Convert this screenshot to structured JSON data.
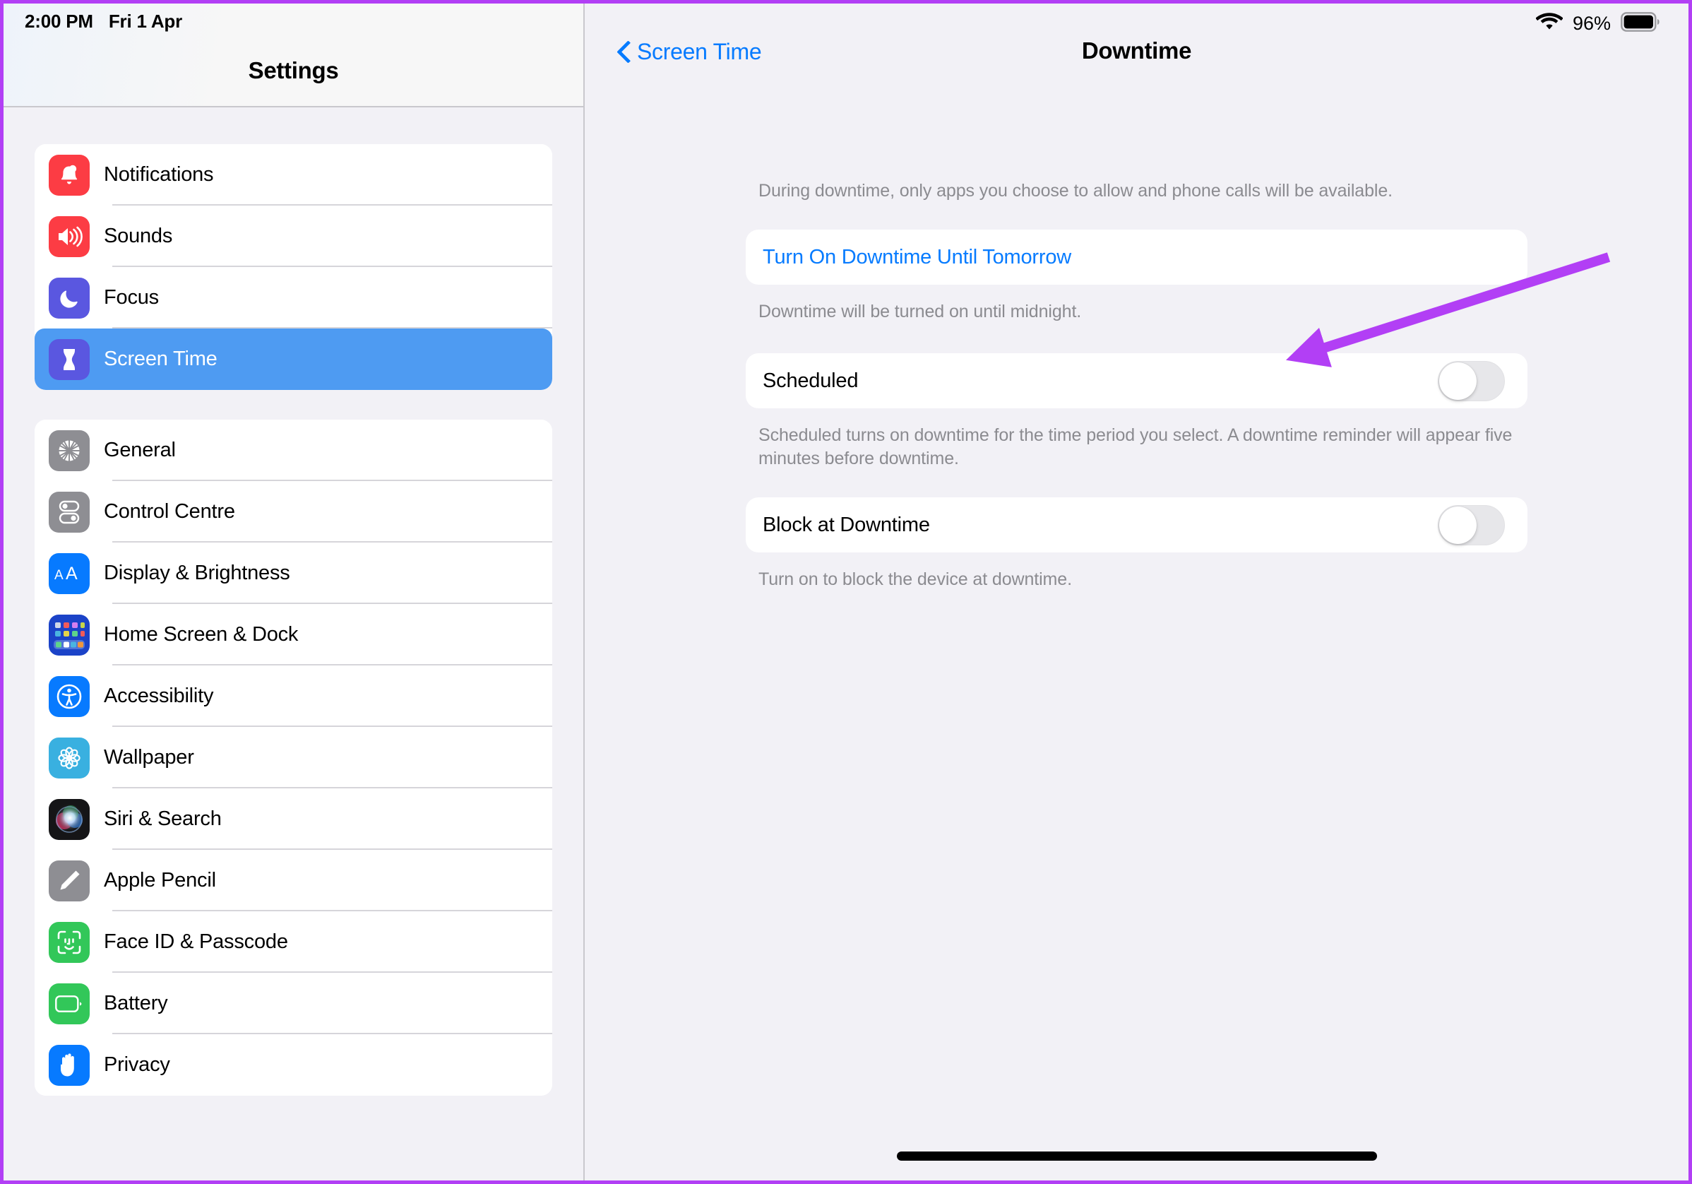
{
  "annotation": {
    "arrow_color": "#b23ff5",
    "frame_color": "#b23ff5"
  },
  "status_bar": {
    "time": "2:00 PM",
    "date": "Fri 1 Apr",
    "wifi_icon": "wifi-icon",
    "battery_percent": "96%",
    "battery_icon": "battery-full-icon"
  },
  "sidebar": {
    "title": "Settings",
    "groups": [
      {
        "items": [
          {
            "label": "Notifications",
            "icon": "bell-icon",
            "icon_bg": "#fc3c44",
            "selected": false
          },
          {
            "label": "Sounds",
            "icon": "speaker-waves-icon",
            "icon_bg": "#fc3c44",
            "selected": false
          },
          {
            "label": "Focus",
            "icon": "moon-icon",
            "icon_bg": "#5a57e0",
            "selected": false
          },
          {
            "label": "Screen Time",
            "icon": "hourglass-icon",
            "icon_bg": "#5a57e0",
            "selected": true
          }
        ]
      },
      {
        "items": [
          {
            "label": "General",
            "icon": "gear-icon",
            "icon_bg": "#8e8e93",
            "selected": false
          },
          {
            "label": "Control Centre",
            "icon": "control-toggles-icon",
            "icon_bg": "#8e8e93",
            "selected": false
          },
          {
            "label": "Display & Brightness",
            "icon": "aa-text-icon",
            "icon_bg": "#077aff",
            "selected": false
          },
          {
            "label": "Home Screen & Dock",
            "icon": "home-screen-grid-icon",
            "icon_bg": "#1b43c8",
            "selected": false
          },
          {
            "label": "Accessibility",
            "icon": "accessibility-person-icon",
            "icon_bg": "#077aff",
            "selected": false
          },
          {
            "label": "Wallpaper",
            "icon": "flower-icon",
            "icon_bg": "#39b0e0",
            "selected": false
          },
          {
            "label": "Siri & Search",
            "icon": "siri-orb-icon",
            "icon_bg": "#1c1c1e",
            "selected": false
          },
          {
            "label": "Apple Pencil",
            "icon": "pencil-icon",
            "icon_bg": "#8e8e93",
            "selected": false
          },
          {
            "label": "Face ID & Passcode",
            "icon": "face-id-icon",
            "icon_bg": "#32c759",
            "selected": false
          },
          {
            "label": "Battery",
            "icon": "battery-icon",
            "icon_bg": "#32c759",
            "selected": false
          },
          {
            "label": "Privacy",
            "icon": "hand-icon",
            "icon_bg": "#077aff",
            "selected": false
          }
        ]
      }
    ]
  },
  "detail": {
    "back_label": "Screen Time",
    "back_icon": "chevron-left-icon",
    "title": "Downtime",
    "intro_note": "During downtime, only apps you choose to allow and phone calls will be available.",
    "turn_on_label": "Turn On Downtime Until Tomorrow",
    "turn_on_note": "Downtime will be turned on until midnight.",
    "scheduled_label": "Scheduled",
    "scheduled_state": "off",
    "scheduled_note": "Scheduled turns on downtime for the time period you select. A downtime reminder will appear five minutes before downtime.",
    "block_label": "Block at Downtime",
    "block_state": "off",
    "block_note": "Turn on to block the device at downtime."
  }
}
